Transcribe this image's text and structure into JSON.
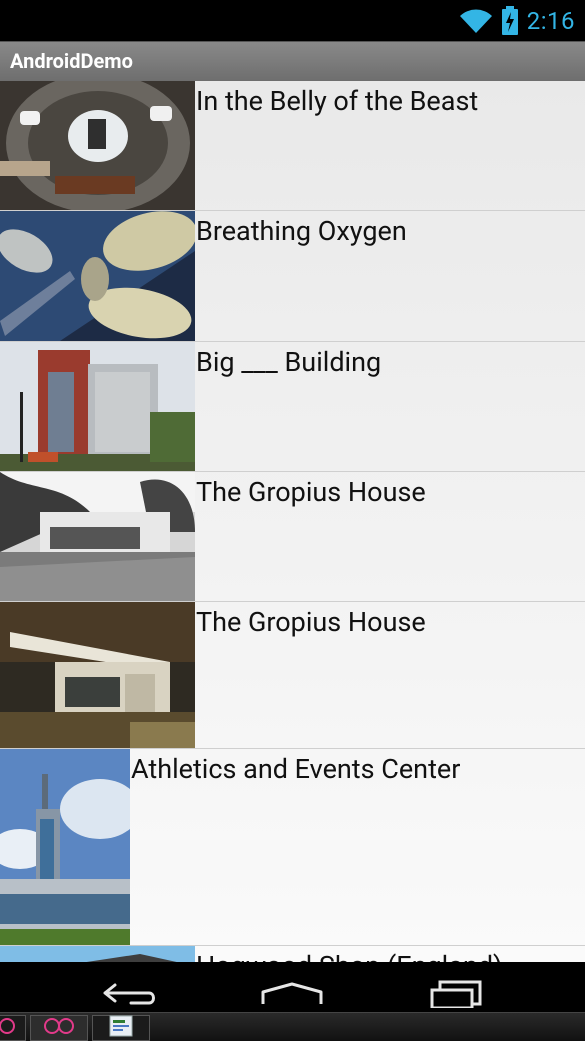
{
  "status_bar": {
    "time": "2:16",
    "wifi_icon": "wifi-icon",
    "battery_icon": "battery-charging-icon"
  },
  "action_bar": {
    "title": "AndroidDemo"
  },
  "list": {
    "items": [
      {
        "title": "In the Belly of the Beast"
      },
      {
        "title": "Breathing Oxygen"
      },
      {
        "title": "Big ___ Building"
      },
      {
        "title": "The Gropius House"
      },
      {
        "title": "The Gropius House"
      },
      {
        "title": "Athletics and Events Center"
      },
      {
        "title": "Hogwood Shop (England)"
      }
    ]
  },
  "nav_bar": {
    "back_icon": "back-icon",
    "home_icon": "home-icon",
    "recents_icon": "recents-icon"
  },
  "taskbar": {
    "items": [
      "app-icon-1",
      "app-icon-2",
      "app-icon-3"
    ]
  }
}
